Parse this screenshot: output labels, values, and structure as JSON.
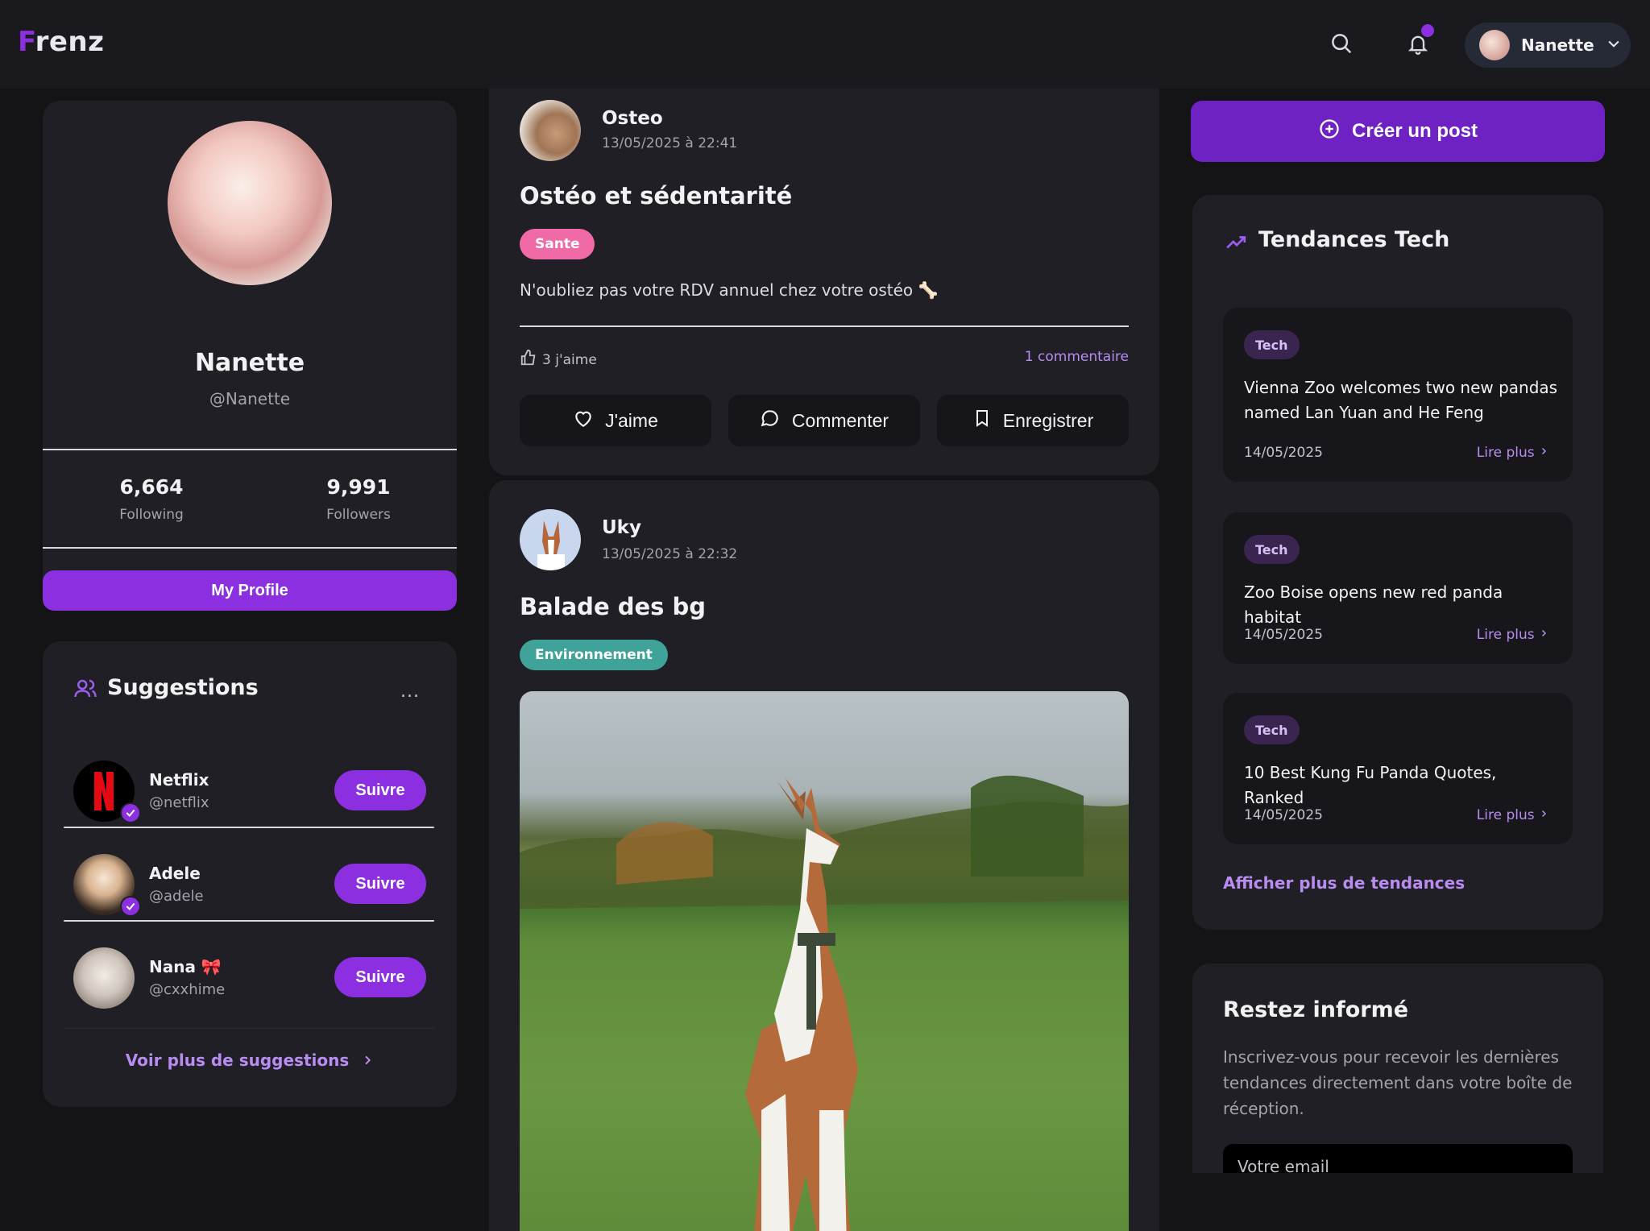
{
  "app": {
    "logo_first": "F",
    "logo_rest": "renz"
  },
  "header": {
    "user_name": "Nanette"
  },
  "profile": {
    "name": "Nanette",
    "handle": "@Nanette",
    "following_count": "6,664",
    "following_label": "Following",
    "followers_count": "9,991",
    "followers_label": "Followers",
    "button": "My Profile"
  },
  "suggestions": {
    "title": "Suggestions",
    "more": "...",
    "items": [
      {
        "name": "Netflix",
        "handle": "@netflix",
        "button": "Suivre"
      },
      {
        "name": "Adele",
        "handle": "@adele",
        "button": "Suivre"
      },
      {
        "name": "Nana 🎀",
        "handle": "@cxxhime",
        "button": "Suivre"
      }
    ],
    "see_more": "Voir plus de suggestions"
  },
  "posts": [
    {
      "author": "Osteo",
      "date": "13/05/2025 à 22:41",
      "title": "Ostéo et sédentarité",
      "tag": "Sante",
      "tag_color": "#f06aa8",
      "body": "N'oubliez pas votre RDV annuel chez votre ostéo 🦴",
      "likes": "3 j'aime",
      "comments": "1 commentaire",
      "actions": {
        "like": "J'aime",
        "comment": "Commenter",
        "save": "Enregistrer"
      }
    },
    {
      "author": "Uky",
      "date": "13/05/2025 à 22:32",
      "title": "Balade des bg",
      "tag": "Environnement",
      "tag_color": "#3fa39a"
    }
  ],
  "create_post": "Créer un post",
  "trends": {
    "title": "Tendances Tech",
    "items": [
      {
        "tag": "Tech",
        "title": "Vienna Zoo welcomes two new pandas named Lan Yuan and He Feng",
        "date": "14/05/2025",
        "read": "Lire plus"
      },
      {
        "tag": "Tech",
        "title": "Zoo Boise opens new red panda habitat",
        "date": "14/05/2025",
        "read": "Lire plus"
      },
      {
        "tag": "Tech",
        "title": "10 Best Kung Fu Panda Quotes, Ranked",
        "date": "14/05/2025",
        "read": "Lire plus"
      }
    ],
    "more": "Afficher plus de tendances"
  },
  "newsletter": {
    "title": "Restez informé",
    "text": "Inscrivez-vous pour recevoir les dernières tendances directement dans votre boîte de réception.",
    "placeholder": "Votre email"
  },
  "colors": {
    "accent": "#8b2fe0",
    "background": "#141417",
    "card": "#1f1f25"
  }
}
